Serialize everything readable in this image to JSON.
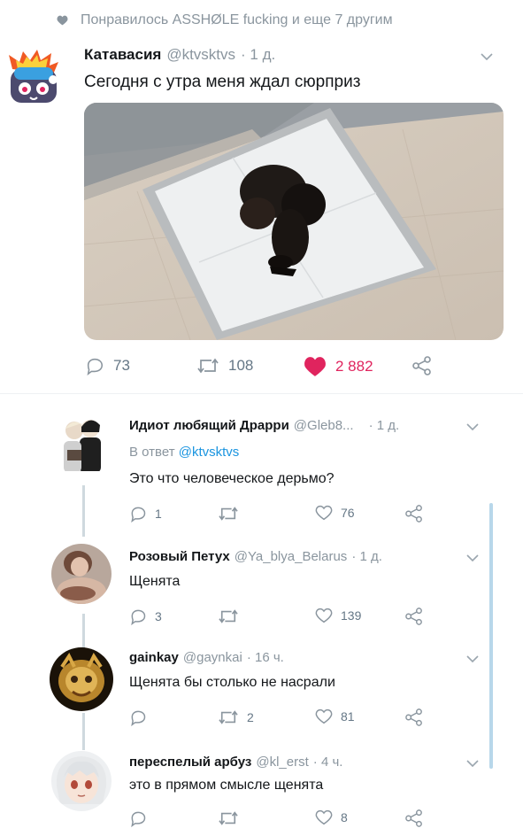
{
  "liked": {
    "text": "Понравилось ASSHØLE fucking и еще 7 другим"
  },
  "main_tweet": {
    "name": "Катавасия",
    "handle": "@ktvsktvs",
    "time": "· 1 д.",
    "text": "Сегодня с утра меня ждал сюрприз",
    "replies": "73",
    "retweets": "108",
    "likes": "2 882",
    "like_color": "#e0245e"
  },
  "replies": [
    {
      "name": "Идиот любящий Драрри",
      "handle": "@Gleb8...",
      "time": "· 1 д.",
      "reply_to_prefix": "В ответ",
      "reply_to_handle": "@ktvsktvs",
      "text": "Это что человеческое дерьмо?",
      "replies": "1",
      "retweets": "",
      "likes": "76"
    },
    {
      "name": "Розовый Петух",
      "handle": "@Ya_blya_Belarus",
      "time": "· 1 д.",
      "text": "Щенята",
      "replies": "3",
      "retweets": "",
      "likes": "139"
    },
    {
      "name": "gainkay",
      "handle": "@gaynkai",
      "time": "· 16 ч.",
      "text": "Щенята бы столько не насрали",
      "replies": "",
      "retweets": "2",
      "likes": "81"
    },
    {
      "name": "переспелый арбуз",
      "handle": "@kl_erst",
      "time": "· 4 ч.",
      "text": "это в прямом смысле щенята",
      "replies": "",
      "retweets": "",
      "likes": "8"
    }
  ]
}
